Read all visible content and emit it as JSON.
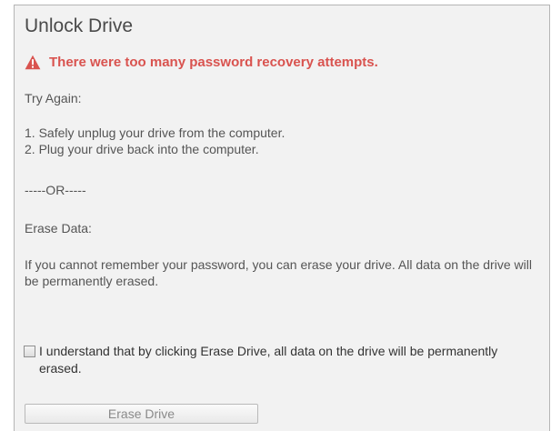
{
  "dialog": {
    "title": "Unlock Drive",
    "error": {
      "icon": "warning-icon",
      "color": "#d9534f",
      "message": "There were too many password recovery attempts."
    },
    "try_again_heading": "Try Again:",
    "steps": [
      "1. Safely unplug your drive from the computer.",
      "2. Plug your drive back into the computer."
    ],
    "separator": "-----OR-----",
    "erase_heading": "Erase Data:",
    "erase_description": "If you cannot remember your password, you can erase your drive. All data on the drive will be permanently erased.",
    "confirm_checkbox": {
      "checked": false,
      "label": "I understand that by clicking Erase Drive, all data on the drive will be permanently erased."
    },
    "erase_button": {
      "label": "Erase Drive",
      "enabled": false
    }
  }
}
